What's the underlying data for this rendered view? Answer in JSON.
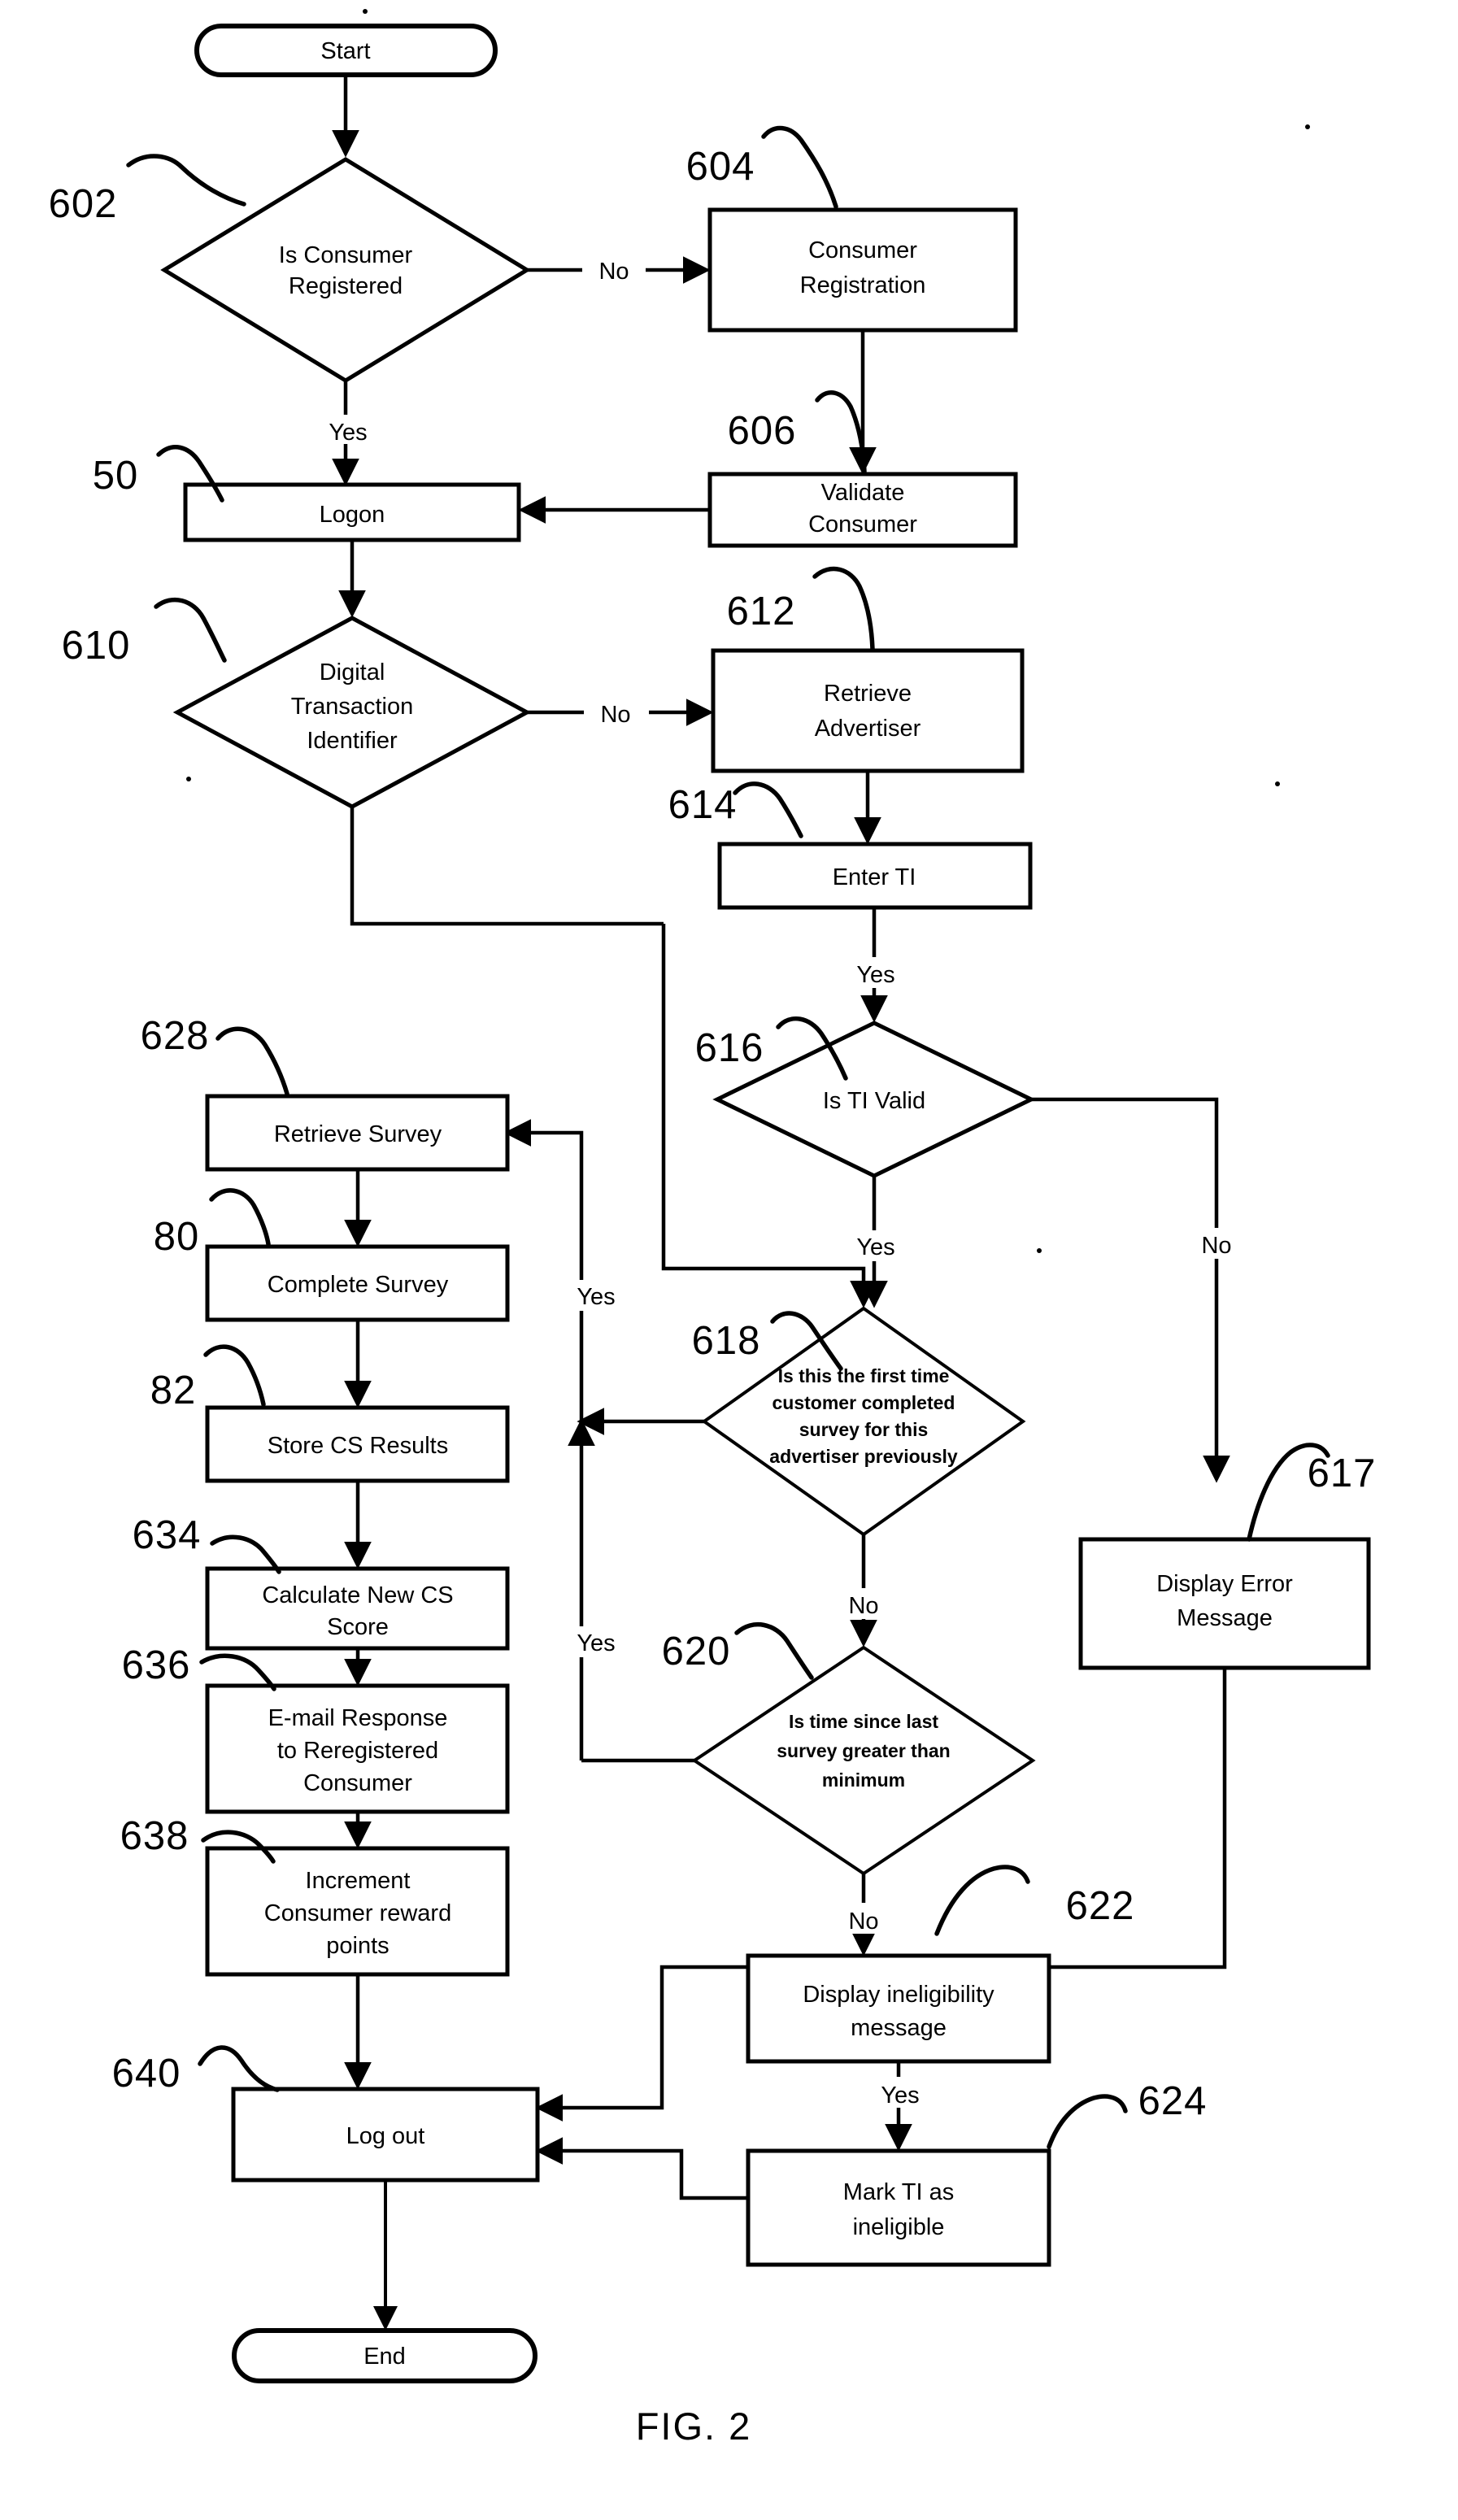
{
  "figure": {
    "caption": "FIG. 2",
    "type": "flowchart"
  },
  "nodes": {
    "start": {
      "label": "Start",
      "shape": "terminator"
    },
    "is_consumer_registered": {
      "label_line1": "Is Consumer",
      "label_line2": "Registered",
      "shape": "decision",
      "ref": "602"
    },
    "consumer_registration": {
      "label_line1": "Consumer",
      "label_line2": "Registration",
      "shape": "process",
      "ref": "604"
    },
    "validate_consumer": {
      "label_line1": "Validate",
      "label_line2": "Consumer",
      "shape": "process",
      "ref": "606"
    },
    "logon": {
      "label": "Logon",
      "shape": "process",
      "ref": "50"
    },
    "digital_transaction_identifier": {
      "label_line1": "Digital",
      "label_line2": "Transaction",
      "label_line3": "Identifier",
      "shape": "decision",
      "ref": "610"
    },
    "retrieve_advertiser": {
      "label_line1": "Retrieve",
      "label_line2": "Advertiser",
      "shape": "process",
      "ref": "612"
    },
    "enter_ti": {
      "label": "Enter TI",
      "shape": "process",
      "ref": "614"
    },
    "is_ti_valid": {
      "label": "Is TI Valid",
      "shape": "decision",
      "ref": "616"
    },
    "display_error_message": {
      "label_line1": "Display Error",
      "label_line2": "Message",
      "shape": "process",
      "ref": "617"
    },
    "first_time_survey": {
      "label_line1": "Is this the first time",
      "label_line2": "customer completed",
      "label_line3": "survey for this",
      "label_line4": "advertiser previously",
      "shape": "decision",
      "ref": "618"
    },
    "time_since_last_survey": {
      "label_line1": "Is time since last",
      "label_line2": "survey greater than",
      "label_line3": "minimum",
      "shape": "decision",
      "ref": "620"
    },
    "display_ineligibility_message": {
      "label_line1": "Display ineligibility",
      "label_line2": "message",
      "shape": "process",
      "ref": "622"
    },
    "mark_ti_ineligible": {
      "label_line1": "Mark TI as",
      "label_line2": "ineligible",
      "shape": "process",
      "ref": "624"
    },
    "retrieve_survey": {
      "label": "Retrieve Survey",
      "shape": "process",
      "ref": "628"
    },
    "complete_survey": {
      "label": "Complete Survey",
      "shape": "process",
      "ref": "80"
    },
    "store_cs_results": {
      "label": "Store CS Results",
      "shape": "process",
      "ref": "82"
    },
    "calculate_new_cs_score": {
      "label_line1": "Calculate New CS",
      "label_line2": "Score",
      "shape": "process",
      "ref": "634"
    },
    "email_response": {
      "label_line1": "E-mail Response",
      "label_line2": "to Reregistered",
      "label_line3": "Consumer",
      "shape": "process",
      "ref": "636"
    },
    "increment_reward_points": {
      "label_line1": "Increment",
      "label_line2": "Consumer reward",
      "label_line3": "points",
      "shape": "process",
      "ref": "638"
    },
    "log_out": {
      "label": "Log out",
      "shape": "process",
      "ref": "640"
    },
    "end": {
      "label": "End",
      "shape": "terminator"
    }
  },
  "edge_labels": {
    "registered_no": "No",
    "registered_yes": "Yes",
    "dti_no": "No",
    "enter_ti_yes": "Yes",
    "ti_valid_yes": "Yes",
    "ti_valid_no": "No",
    "first_time_no": "No",
    "first_time_yes": "Yes",
    "time_since_no": "No",
    "time_since_yes": "Yes",
    "ineligibility_yes": "Yes"
  },
  "reference_numerals": {
    "n602": "602",
    "n604": "604",
    "n606": "606",
    "n50": "50",
    "n610": "610",
    "n612": "612",
    "n614": "614",
    "n616": "616",
    "n617": "617",
    "n618": "618",
    "n620": "620",
    "n622": "622",
    "n624": "624",
    "n628": "628",
    "n80": "80",
    "n82": "82",
    "n634": "634",
    "n636": "636",
    "n638": "638",
    "n640": "640"
  },
  "colors": {
    "ink": "#000000",
    "paper": "#ffffff"
  }
}
